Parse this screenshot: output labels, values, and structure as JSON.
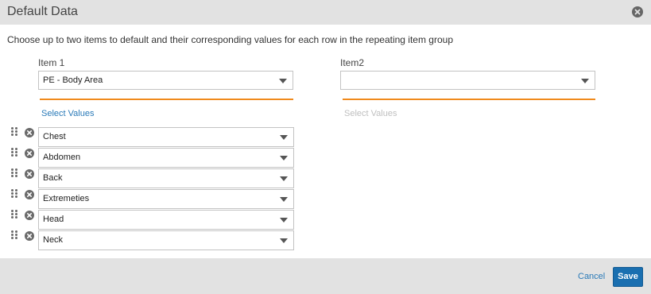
{
  "dialog": {
    "title": "Default Data",
    "instructions": "Choose up to two items to default and their corresponding values for each row in the repeating item group"
  },
  "item1": {
    "label": "Item 1",
    "selected": "PE - Body Area",
    "select_values_label": "Select Values",
    "select_values_state": "enabled"
  },
  "item2": {
    "label": "Item2",
    "selected": "",
    "select_values_label": "Select Values",
    "select_values_state": "disabled"
  },
  "rows": [
    {
      "value": "Chest"
    },
    {
      "value": "Abdomen"
    },
    {
      "value": "Back"
    },
    {
      "value": "Extremeties"
    },
    {
      "value": "Head"
    },
    {
      "value": "Neck"
    }
  ],
  "footer": {
    "cancel_label": "Cancel",
    "save_label": "Save"
  },
  "colors": {
    "accent_rule": "#f08a1c",
    "link": "#2a7ab8",
    "primary_button": "#1a6fb0"
  },
  "icons": {
    "close": "close-circle-icon",
    "remove_row": "remove-circle-icon",
    "drag": "drag-handle-icon",
    "dropdown": "chevron-down-icon"
  }
}
